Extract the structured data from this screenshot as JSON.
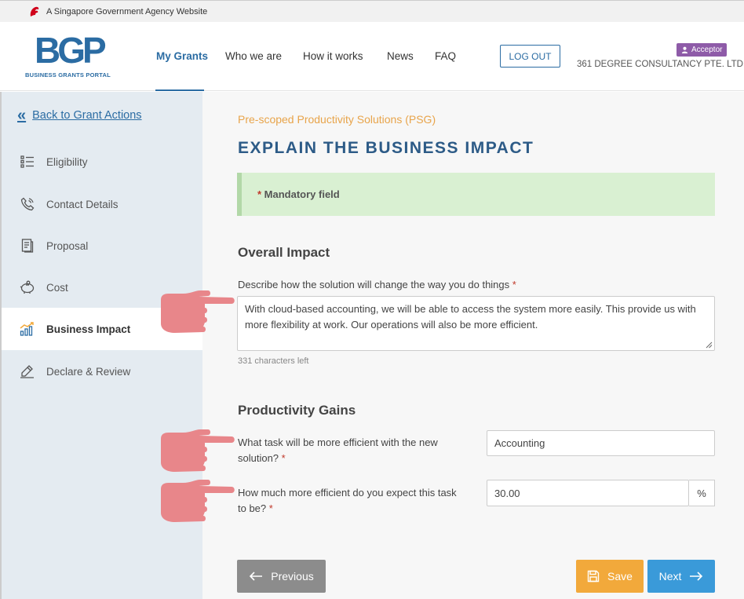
{
  "gov_banner": {
    "text": "A Singapore Government Agency Website"
  },
  "header": {
    "logo_main": "BGP",
    "logo_sub": "BUSINESS GRANTS PORTAL",
    "nav": [
      "My Grants",
      "Who we are",
      "How it works",
      "News",
      "FAQ"
    ],
    "active_nav": "My Grants",
    "logout_label": "LOG OUT",
    "role": "Acceptor",
    "company": "361 DEGREE CONSULTANCY PTE. LTD."
  },
  "sidebar": {
    "back_label": "Back to Grant Actions",
    "items": [
      {
        "label": "Eligibility",
        "icon": "list-icon"
      },
      {
        "label": "Contact Details",
        "icon": "phone-icon"
      },
      {
        "label": "Proposal",
        "icon": "document-icon"
      },
      {
        "label": "Cost",
        "icon": "piggy-bank-icon"
      },
      {
        "label": "Business Impact",
        "icon": "bar-chart-icon",
        "active": true
      },
      {
        "label": "Declare & Review",
        "icon": "pen-icon"
      }
    ]
  },
  "main": {
    "grant_type": "Pre-scoped Productivity Solutions (PSG)",
    "title": "EXPLAIN THE BUSINESS IMPACT",
    "mandatory_note": "Mandatory field",
    "overall": {
      "heading": "Overall Impact",
      "question": "Describe how the solution will change the way you do things",
      "answer": "With cloud-based accounting, we will be able to access the system more easily. This provide us with more flexibility at work. Our operations will also be more efficient.",
      "chars_left": "331 characters left"
    },
    "productivity": {
      "heading": "Productivity Gains",
      "task_question": "What task will be more efficient with the new solution?",
      "task_answer": "Accounting",
      "efficiency_question": "How much more efficient do you expect this task to be?",
      "efficiency_answer": "30.00",
      "efficiency_unit": "%"
    },
    "buttons": {
      "previous": "Previous",
      "save": "Save",
      "next": "Next"
    }
  },
  "colors": {
    "brand_blue": "#2b6ca3",
    "accent_orange": "#e8a44a",
    "role_purple": "#8e5ba8",
    "pointer_pink": "#e8868a"
  }
}
